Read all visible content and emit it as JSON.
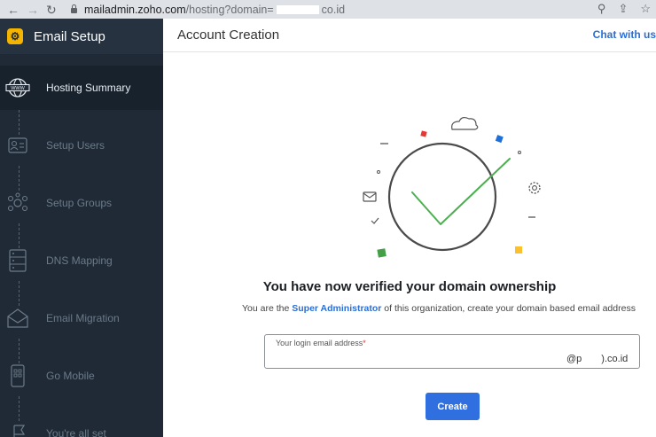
{
  "browser": {
    "url_host": "mailadmin.zoho.com",
    "url_path_prefix": "/hosting?domain=",
    "url_path_suffix": "co.id",
    "icons": [
      "back-arrow-icon",
      "forward-arrow-icon",
      "reload-icon",
      "lock-icon",
      "zoom-icon",
      "share-icon",
      "bookmark-star-icon"
    ]
  },
  "sidebar": {
    "title": "Email Setup",
    "steps": [
      {
        "label": "Hosting Summary",
        "icon": "globe-www-icon",
        "active": true
      },
      {
        "label": "Setup Users",
        "icon": "user-card-icon",
        "active": false
      },
      {
        "label": "Setup Groups",
        "icon": "group-icon",
        "active": false
      },
      {
        "label": "DNS Mapping",
        "icon": "dns-server-icon",
        "active": false
      },
      {
        "label": "Email Migration",
        "icon": "email-migration-icon",
        "active": false
      },
      {
        "label": "Go Mobile",
        "icon": "mobile-icon",
        "active": false
      },
      {
        "label": "You're all set",
        "icon": "flag-icon",
        "active": false
      }
    ]
  },
  "header": {
    "title": "Account Creation",
    "chat_link": "Chat with us"
  },
  "content": {
    "headline": "You have now verified your domain ownership",
    "subline_prefix": "You are the ",
    "subline_role": "Super Administrator",
    "subline_suffix": " of this organization, create your domain based email address",
    "field_label": "Your login email address",
    "field_required_mark": "*",
    "field_value": "",
    "domain_prefix": "@p",
    "domain_suffix": ").co.id",
    "create_label": "Create"
  },
  "colors": {
    "sidebar_bg": "#1f2a36",
    "accent_blue": "#2f6fdf",
    "check_green": "#4caf50"
  }
}
